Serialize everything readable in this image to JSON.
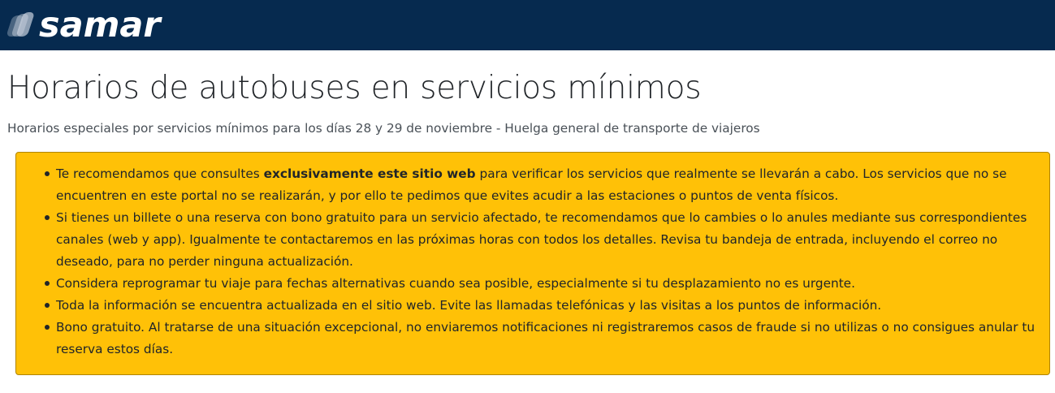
{
  "header": {
    "logo_text": "samar",
    "background_color": "#062a4f"
  },
  "page": {
    "title": "Horarios de autobuses en servicios mínimos",
    "subtitle": "Horarios especiales por servicios mínimos para los días 28 y 29 de noviembre - Huelga general de transporte de viajeros"
  },
  "notice": {
    "background_color": "#ffc107",
    "items": [
      {
        "before": "Te recomendamos que consultes ",
        "bold": "exclusivamente este sitio web",
        "after": " para verificar los servicios que realmente se llevarán a cabo. Los servicios que no se encuentren en este portal no se realizarán, y por ello te pedimos que evites acudir a las estaciones o puntos de venta físicos."
      },
      {
        "text": "Si tienes un billete o una reserva con bono gratuito para un servicio afectado, te recomendamos que lo cambies o lo anules mediante sus correspondientes canales (web y app). Igualmente te contactaremos en las próximas horas con todos los detalles. Revisa tu bandeja de entrada, incluyendo el correo no deseado, para no perder ninguna actualización."
      },
      {
        "text": "Considera reprogramar tu viaje para fechas alternativas cuando sea posible, especialmente si tu desplazamiento no es urgente."
      },
      {
        "text": "Toda la información se encuentra actualizada en el sitio web. Evite las llamadas telefónicas y las visitas a los puntos de información."
      },
      {
        "text": "Bono gratuito. Al tratarse de una situación excepcional, no enviaremos notificaciones ni registraremos casos de fraude si no utilizas o no consigues anular tu reserva estos días."
      }
    ]
  }
}
